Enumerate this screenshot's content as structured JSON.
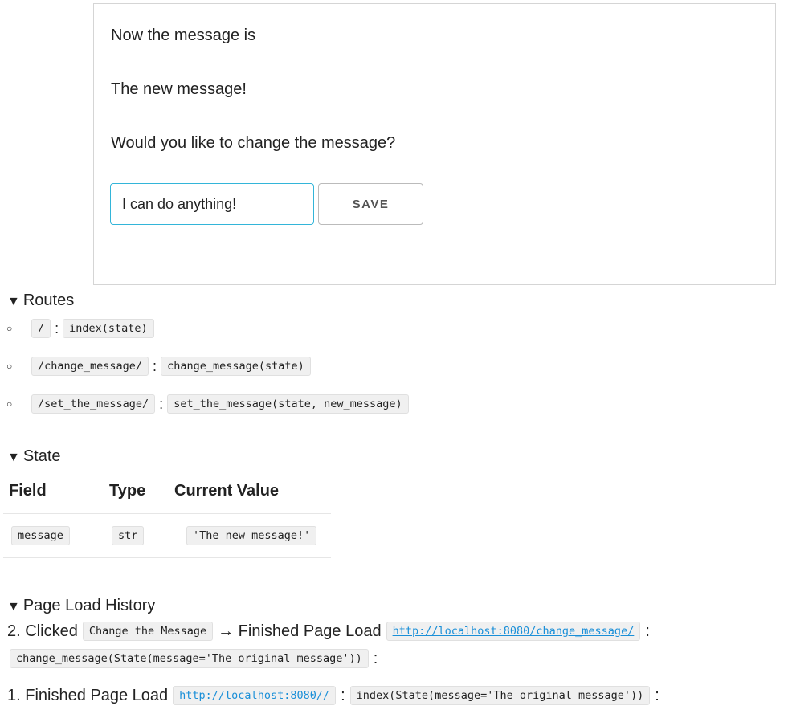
{
  "preview": {
    "line1": "Now the message is",
    "line2": "The new message!",
    "line3": "Would you like to change the message?",
    "input_value": "I can do anything!",
    "save_label": "SAVE"
  },
  "routes": {
    "title": "Routes",
    "items": [
      {
        "path": "/",
        "handler": "index(state)"
      },
      {
        "path": "/change_message/",
        "handler": "change_message(state)"
      },
      {
        "path": "/set_the_message/",
        "handler": "set_the_message(state, new_message)"
      }
    ]
  },
  "state": {
    "title": "State",
    "headers": [
      "Field",
      "Type",
      "Current Value"
    ],
    "rows": [
      {
        "field": "message",
        "type": "str",
        "value": "'The new message!'"
      }
    ]
  },
  "history": {
    "title": "Page Load History",
    "entry2": {
      "prefix": "2. Clicked",
      "clicked": "Change the Message",
      "arrow_text": "→ Finished Page Load",
      "url": "http://localhost:8080/change_message/",
      "call": "change_message(State(message='The original message'))"
    },
    "entry1": {
      "prefix": "1. Finished Page Load",
      "url": "http://localhost:8080//",
      "call": "index(State(message='The original message'))"
    },
    "colon": ":"
  }
}
